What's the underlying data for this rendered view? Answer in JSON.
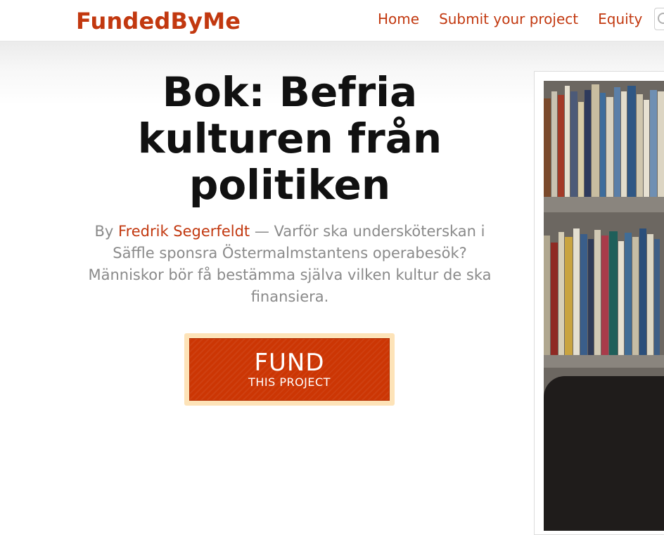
{
  "navbar": {
    "logo": "FundedByMe",
    "links": [
      "Home",
      "Submit your project",
      "Equity"
    ],
    "search_icon": "search-icon"
  },
  "project": {
    "title": "Bok: Befria kulturen från politiken",
    "by_prefix": "By",
    "author": "Fredrik Segerfeldt",
    "description": " — Varför ska undersköterskan i Säffle sponsra Östermalmstantens operabesök? Människor bör få bestämma själva vilken kultur de ska finansiera."
  },
  "fund_button": {
    "main": "FUND",
    "sub": "THIS PROJECT"
  },
  "colors": {
    "brand": "#c2380f",
    "button": "#cc3604",
    "button_border": "#fde3b8"
  }
}
